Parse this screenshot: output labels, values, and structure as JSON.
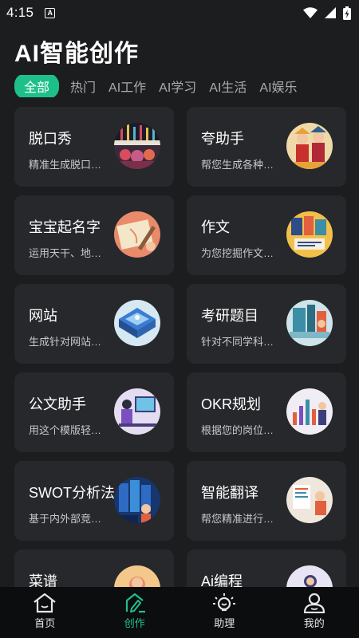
{
  "status": {
    "time": "4:15",
    "app_badge": "A"
  },
  "title": "AI智能创作",
  "tabs": [
    {
      "label": "全部",
      "active": true
    },
    {
      "label": "热门"
    },
    {
      "label": "AI工作"
    },
    {
      "label": "AI学习"
    },
    {
      "label": "AI生活"
    },
    {
      "label": "AI娱乐"
    }
  ],
  "cards": [
    {
      "title": "脱口秀",
      "desc": "精准生成脱口秀文案",
      "icon": "comedy-stage-thumb"
    },
    {
      "title": "夸助手",
      "desc": "帮您生成各种夸赞",
      "icon": "praise-thumb"
    },
    {
      "title": "宝宝起名字",
      "desc": "运用天干、地支取名",
      "icon": "baby-name-thumb"
    },
    {
      "title": "作文",
      "desc": "为您挖掘作文灵感",
      "icon": "essay-thumb"
    },
    {
      "title": "网站",
      "desc": "生成针对网站的方案",
      "icon": "website-thumb"
    },
    {
      "title": "考研题目",
      "desc": "针对不同学科生成题目",
      "icon": "exam-thumb"
    },
    {
      "title": "公文助手",
      "desc": "用这个模版轻松写公文",
      "icon": "document-thumb"
    },
    {
      "title": "OKR规划",
      "desc": "根据您的岗位生成规划",
      "icon": "okr-thumb"
    },
    {
      "title": "SWOT分析法",
      "desc": "基于内外部竞争环境",
      "icon": "swot-thumb"
    },
    {
      "title": "智能翻译",
      "desc": "帮您精准进行翻译",
      "icon": "translate-thumb"
    },
    {
      "title": "菜谱",
      "desc": "",
      "icon": "recipe-thumb"
    },
    {
      "title": "Ai编程",
      "desc": "",
      "icon": "coding-thumb"
    }
  ],
  "nav": [
    {
      "label": "首页",
      "icon": "home-icon"
    },
    {
      "label": "创作",
      "icon": "create-icon",
      "active": true
    },
    {
      "label": "助理",
      "icon": "assistant-icon"
    },
    {
      "label": "我的",
      "icon": "profile-icon"
    }
  ],
  "colors": {
    "accent": "#1ec08a",
    "background": "#1c1d1f",
    "card": "#26282b",
    "nav_bg": "#0c0d0f"
  }
}
